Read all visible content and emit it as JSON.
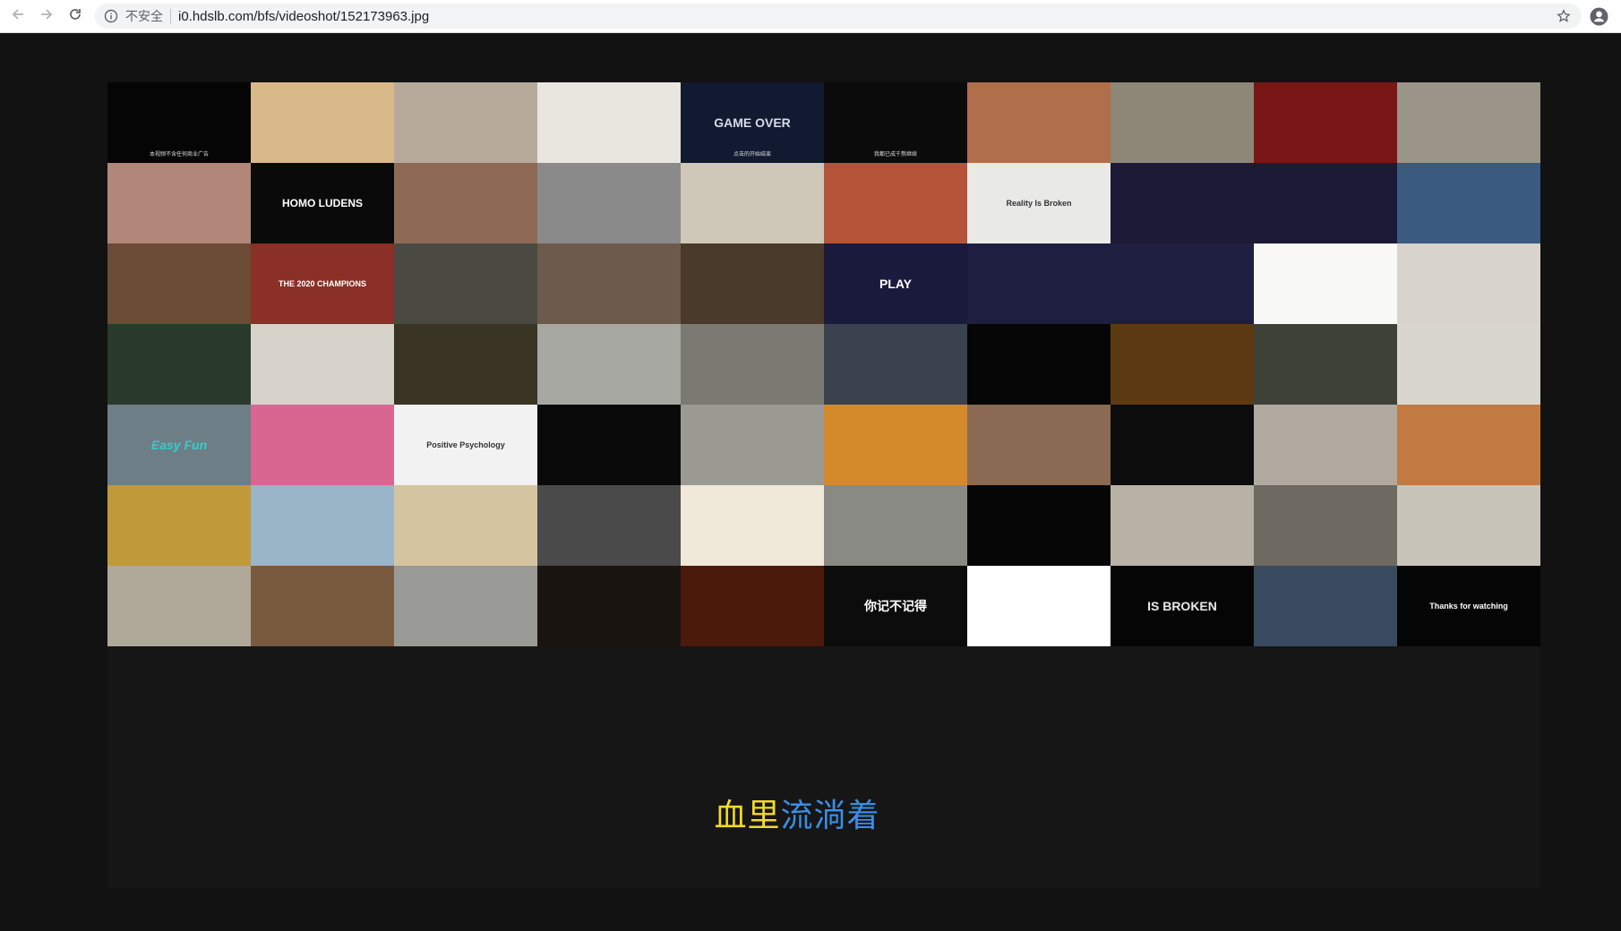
{
  "browser": {
    "security_label": "不安全",
    "url": "i0.hdslb.com/bfs/videoshot/152173963.jpg",
    "icons": [
      "back-arrow-icon",
      "forward-arrow-icon",
      "reload-icon",
      "info-icon",
      "star-icon",
      "account-icon"
    ]
  },
  "frames": [
    {
      "caption": "本视频不含任何商业广告",
      "bg": "#050505"
    },
    {
      "caption": "",
      "bg": "#d9b98a"
    },
    {
      "caption": "",
      "bg": "#b7aa9a"
    },
    {
      "caption": "",
      "bg": "#e9e6e0"
    },
    {
      "title": "GAME OVER",
      "caption": "点击的开始结束",
      "bg": "#111a30"
    },
    {
      "caption": "我都已成千熬继续",
      "bg": "#0b0b0b"
    },
    {
      "caption": "",
      "bg": "#b06e4b"
    },
    {
      "caption": "",
      "bg": "#8d8778"
    },
    {
      "caption": "",
      "bg": "#7a1616"
    },
    {
      "caption": "",
      "bg": "#9a9489"
    },
    {
      "caption": "",
      "bg": "#b2877a"
    },
    {
      "title": "HOMO LUDENS",
      "caption": "",
      "bg": "#0a0a0a"
    },
    {
      "caption": "",
      "bg": "#8e6a55"
    },
    {
      "caption": "",
      "bg": "#8a8a8a"
    },
    {
      "caption": "",
      "bg": "#cfc7b8"
    },
    {
      "caption": "",
      "bg": "#b55438"
    },
    {
      "title": "Reality Is Broken",
      "caption": "",
      "bg": "#e9e9e6"
    },
    {
      "caption": "",
      "bg": "#1c1a36"
    },
    {
      "caption": "",
      "bg": "#1c1a36"
    },
    {
      "caption": "",
      "bg": "#3a5a80"
    },
    {
      "caption": "",
      "bg": "#6b4a36"
    },
    {
      "title": "THE 2020 CHAMPIONS",
      "caption": "",
      "bg": "#8a3026"
    },
    {
      "caption": "",
      "bg": "#4a4a42"
    },
    {
      "caption": "",
      "bg": "#6e5a4a"
    },
    {
      "caption": "",
      "bg": "#4a3a2a"
    },
    {
      "title": "PLAY",
      "caption": "",
      "bg": "#1a1a3c"
    },
    {
      "caption": "",
      "bg": "#1e1e40"
    },
    {
      "caption": "",
      "bg": "#1e1e40"
    },
    {
      "caption": "",
      "bg": "#f8f8f6"
    },
    {
      "caption": "",
      "bg": "#d8d4cc"
    },
    {
      "caption": "",
      "bg": "#2a3a2a"
    },
    {
      "caption": "",
      "bg": "#d6d2ca"
    },
    {
      "caption": "",
      "bg": "#3a3424"
    },
    {
      "caption": "",
      "bg": "#a8a8a2"
    },
    {
      "caption": "",
      "bg": "#7a7a72"
    },
    {
      "caption": "",
      "bg": "#3a4250"
    },
    {
      "caption": "",
      "bg": "#060606"
    },
    {
      "caption": "",
      "bg": "#5e3a12"
    },
    {
      "caption": "",
      "bg": "#3e4236"
    },
    {
      "caption": "",
      "bg": "#d8d6cf"
    },
    {
      "title": "Easy Fun",
      "caption": "",
      "bg": "#6e7e86"
    },
    {
      "caption": "",
      "bg": "#d86690"
    },
    {
      "title": "Positive Psychology",
      "caption": "",
      "bg": "#f2f2f2"
    },
    {
      "caption": "",
      "bg": "#0a0a0a"
    },
    {
      "caption": "",
      "bg": "#9a9a92"
    },
    {
      "caption": "",
      "bg": "#d48a2a"
    },
    {
      "caption": "",
      "bg": "#8a6a52"
    },
    {
      "caption": "",
      "bg": "#0c0c0c"
    },
    {
      "caption": "",
      "bg": "#b0aaa0"
    },
    {
      "caption": "",
      "bg": "#c07a42"
    },
    {
      "caption": "",
      "bg": "#c09a3a"
    },
    {
      "caption": "",
      "bg": "#9ab4c8"
    },
    {
      "caption": "",
      "bg": "#d4c5a0"
    },
    {
      "caption": "",
      "bg": "#4a4a4a"
    },
    {
      "caption": "",
      "bg": "#f0e8d8"
    },
    {
      "caption": "",
      "bg": "#8a8a84"
    },
    {
      "caption": "",
      "bg": "#060606"
    },
    {
      "caption": "",
      "bg": "#b8b2a6"
    },
    {
      "caption": "",
      "bg": "#6e6a62"
    },
    {
      "caption": "",
      "bg": "#c8c4ba"
    },
    {
      "caption": "",
      "bg": "#b0a898"
    },
    {
      "caption": "",
      "bg": "#7a5a3e"
    },
    {
      "caption": "",
      "bg": "#9a9a96"
    },
    {
      "caption": "",
      "bg": "#1a1410"
    },
    {
      "caption": "",
      "bg": "#4a1a0a"
    },
    {
      "title": "你记不记得",
      "caption": "",
      "bg": "#0c0c0c"
    },
    {
      "caption": "",
      "bg": "#ffffff"
    },
    {
      "title": "IS BROKEN",
      "caption": "",
      "bg": "#050505"
    },
    {
      "caption": "",
      "bg": "#3a4a5e"
    },
    {
      "title": "Thanks for watching",
      "caption": "",
      "bg": "#050505"
    }
  ],
  "lyric": {
    "part1": "血里",
    "part2": "流淌着"
  }
}
